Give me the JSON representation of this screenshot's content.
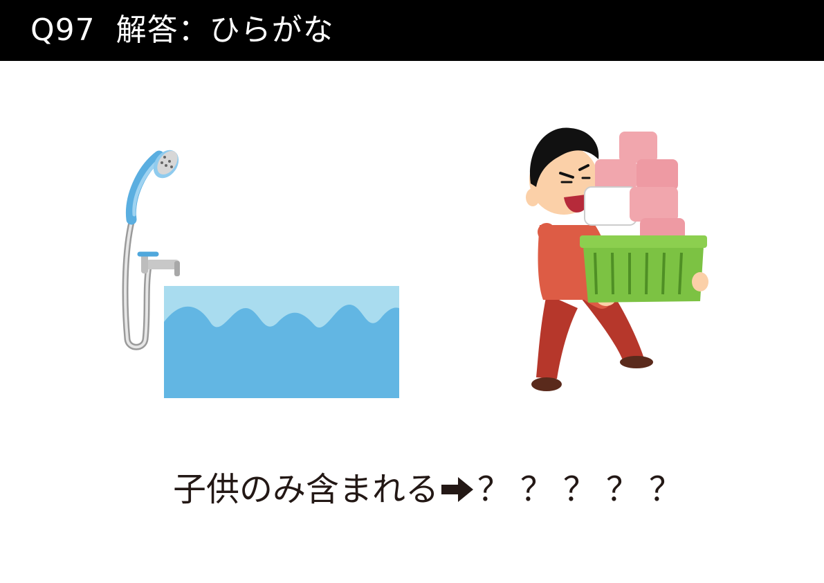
{
  "header": {
    "question_number": "Q97",
    "title": "解答：ひらがな"
  },
  "illustrations": {
    "left": "bathtub-with-shower-icon",
    "right": "boy-carrying-laundry-basket-icon"
  },
  "puzzle": {
    "clue": "子供のみ含まれる",
    "arrow": "arrow-right-icon",
    "answer": "？？？？？"
  },
  "colors": {
    "header_bg": "#000000",
    "header_text": "#ffffff",
    "text": "#231815",
    "water_light": "#a9dcef",
    "water": "#62b6e3",
    "shirt": "#dd5c45",
    "pants": "#b6372b",
    "basket": "#7cc243",
    "stools": "#f1a6ad"
  }
}
